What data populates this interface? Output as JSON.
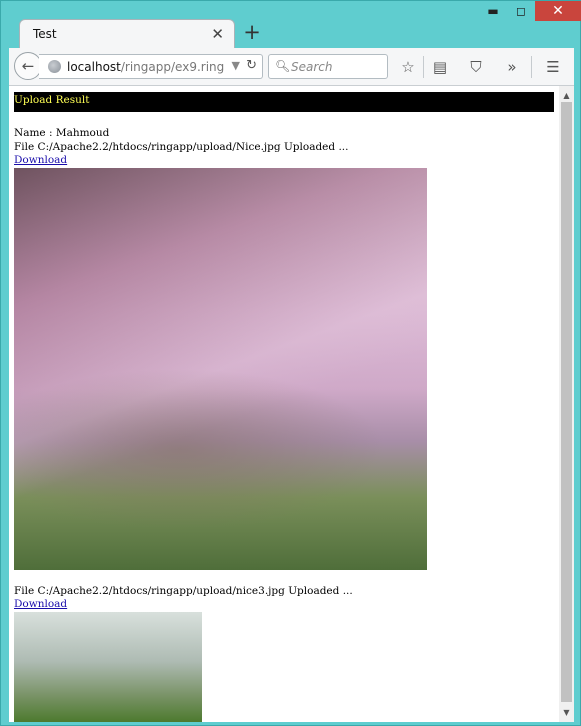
{
  "window": {
    "controls": {
      "minimize": "▬",
      "maximize": "◻",
      "close": "✕"
    }
  },
  "tab": {
    "title": "Test",
    "close": "✕",
    "new_tab": "+"
  },
  "toolbar": {
    "back": "←",
    "url_host": "localhost",
    "url_path": "/ringapp/ex9.ring",
    "search_placeholder": "Search",
    "icons": [
      "star-icon",
      "reading-list-icon",
      "pocket-icon",
      "overflow-icon",
      "menu-icon"
    ]
  },
  "page": {
    "header": "Upload Result",
    "name_line": "Name : Mahmoud",
    "files": [
      {
        "status": "File C:/Apache2.2/htdocs/ringapp/upload/Nice.jpg Uploaded ...",
        "link": "Download"
      },
      {
        "status": "File C:/Apache2.2/htdocs/ringapp/upload/nice3.jpg Uploaded ...",
        "link": "Download"
      }
    ]
  },
  "colors": {
    "header_bg": "#000000",
    "header_text": "#ffff55",
    "link": "#1a0dab",
    "window_frame": "#5fcdcf",
    "close_button": "#c9453d"
  }
}
